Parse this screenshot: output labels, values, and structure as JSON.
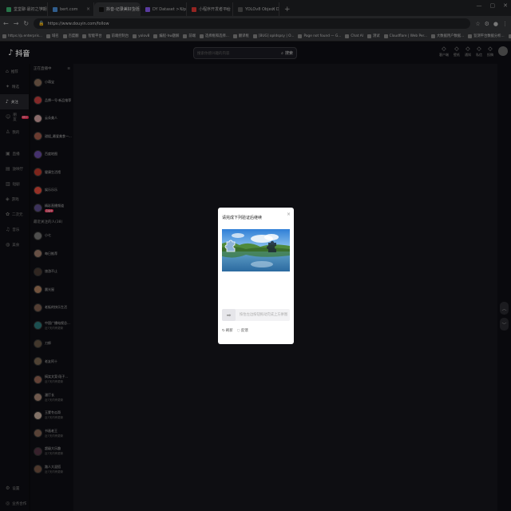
{
  "browser": {
    "tabs": [
      {
        "label": "堂堂聊·最初之学期",
        "color": "#3cb371"
      },
      {
        "label": "bert.com",
        "color": "#4a90d9"
      },
      {
        "label": "抖音-记录美好生活",
        "color": "#111111",
        "active": true
      },
      {
        "label": "DY Dataset > Upload",
        "color": "#8b5cf6"
      },
      {
        "label": "小程序开发者平台",
        "color": "#e53935"
      },
      {
        "label": "YOLOv8 Object Detection",
        "color": "#555555"
      }
    ],
    "new_tab": "+",
    "url": "https://www.douyin.com/follow",
    "window_controls": {
      "minimize": "—",
      "maximize": "▢",
      "close": "✕"
    },
    "bookmarks": [
      "https://p.enterpris...",
      "域名",
      "百度翻",
      "智能平台",
      "前端控制台",
      "yolov8",
      "编程-hw题解",
      "前端",
      "选择框和选择...",
      "翻译框",
      "[BUG] opldspsy | O...",
      "Page not found — G...",
      "Chat AI",
      "测试",
      "Cloudflare | Web Per...",
      "大数据用户数据...",
      "监测平台数据分析...",
      "Kubernetes Dashbo...",
      "机器人平台",
      "微信开发",
      "数据",
      "测试应用检测数据记录..."
    ],
    "bookmarks_overflow": "所有书签"
  },
  "app": {
    "logo": "抖音",
    "search_placeholder": "搜索你感兴趣的内容",
    "search_button": "搜索",
    "header_icons": [
      {
        "label": "客户端",
        "icon": "client-icon"
      },
      {
        "label": "壁纸",
        "icon": "wallpaper-icon"
      },
      {
        "label": "通知",
        "icon": "bell-icon"
      },
      {
        "label": "私信",
        "icon": "message-icon"
      },
      {
        "label": "投稿",
        "icon": "upload-icon"
      }
    ],
    "nav": [
      {
        "label": "推荐",
        "icon": "home-icon"
      },
      {
        "label": "精选",
        "icon": "star-icon"
      },
      {
        "label": "关注",
        "icon": "follow-icon",
        "active": true
      },
      {
        "label": "朋友",
        "icon": "friends-icon",
        "badge": "99+"
      },
      {
        "label": "我的",
        "icon": "profile-icon"
      },
      {
        "label": "直播",
        "icon": "live-icon"
      },
      {
        "label": "放映厅",
        "icon": "cinema-icon"
      },
      {
        "label": "短剧",
        "icon": "drama-icon"
      },
      {
        "label": "游戏",
        "icon": "game-icon"
      },
      {
        "label": "二次元",
        "icon": "anime-icon"
      },
      {
        "label": "音乐",
        "icon": "music-icon"
      },
      {
        "label": "美食",
        "icon": "food-icon"
      }
    ],
    "nav_bottom": [
      {
        "label": "设置",
        "icon": "settings-icon"
      },
      {
        "label": "业务合作",
        "icon": "business-icon"
      }
    ],
    "follow_section_title": "正在直播中",
    "follow_section2_title": "最近关注的人(38)",
    "follow_list": [
      {
        "name": "小萌宝",
        "color": "#8a6d5a"
      },
      {
        "name": "品牌一号·新品推荐",
        "color": "#c94040"
      },
      {
        "name": "云朵美人",
        "color": "#d4a5a5"
      },
      {
        "name": "甜姐_最爱美食一...",
        "color": "#a35b4a"
      },
      {
        "name": "百度地图",
        "color": "#6a4ca8"
      },
      {
        "name": "健康生活馆",
        "color": "#c0392b"
      },
      {
        "name": "娱乐乐乐",
        "color": "#e74c3c"
      },
      {
        "name": "精彩直播频道",
        "color": "#5d4e8c",
        "live": "直播中"
      },
      {
        "name": "小七",
        "color": "#777777"
      },
      {
        "name": "每日推荐",
        "color": "#9e7b6a"
      },
      {
        "name": "旅游不止",
        "color": "#4b3b33"
      },
      {
        "name": "晨光屋",
        "color": "#b08060"
      },
      {
        "name": "老板的快乐生活",
        "color": "#806050"
      },
      {
        "name": "中国广播电视总...",
        "sub": "近7天内有更新",
        "color": "#2c7a7b"
      },
      {
        "name": "刀郎",
        "color": "#665544"
      },
      {
        "name": "老友阿十",
        "color": "#7a6650"
      },
      {
        "name": "搞笑文案·段子...",
        "sub": "近7天内有更新",
        "color": "#996655"
      },
      {
        "name": "潘厅长",
        "sub": "近7天内有更新",
        "color": "#aa8877"
      },
      {
        "name": "玉蒙冬瓜哥",
        "sub": "近7天内有更新",
        "color": "#c8b0a0"
      },
      {
        "name": "书画老王",
        "sub": "近7天内有更新",
        "color": "#886655"
      },
      {
        "name": "超级大乐趣",
        "sub": "近7天内有更新",
        "color": "#553344"
      },
      {
        "name": "路人大混搭",
        "sub": "近7天内有更新",
        "color": "#775544"
      }
    ]
  },
  "captcha": {
    "title": "请完成下列验证后继续",
    "close": "×",
    "slider_hint": "按住左边按钮拖动完成上方拼图",
    "slider_handle": "➡",
    "refresh": "刷新",
    "feedback": "反馈"
  }
}
